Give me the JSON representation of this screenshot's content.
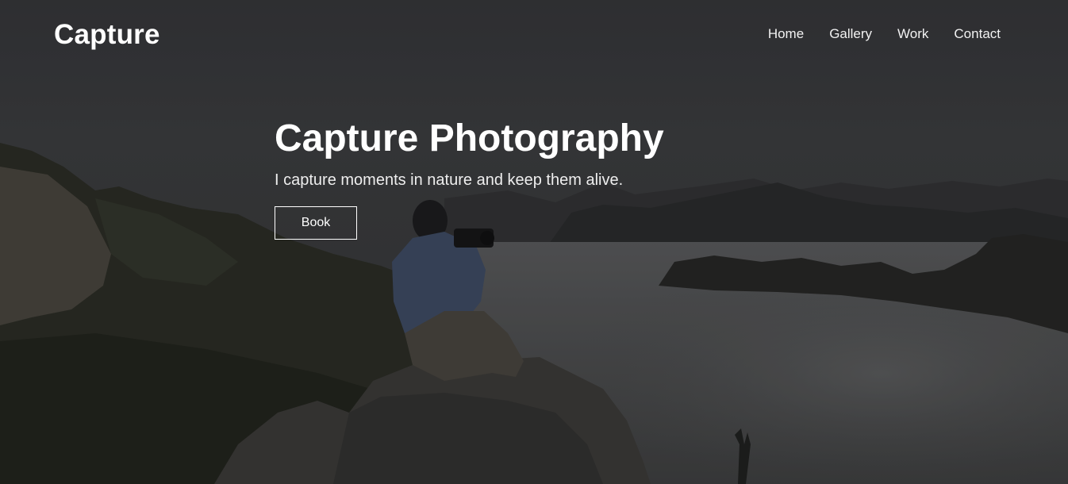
{
  "nav": {
    "logo": "Capture",
    "links": [
      "Home",
      "Gallery",
      "Work",
      "Contact"
    ]
  },
  "hero": {
    "title": "Capture Photography",
    "subtitle": "I capture moments in nature and keep them alive.",
    "cta_label": "Book",
    "background": "photographer-on-rock-above-foggy-valley"
  }
}
